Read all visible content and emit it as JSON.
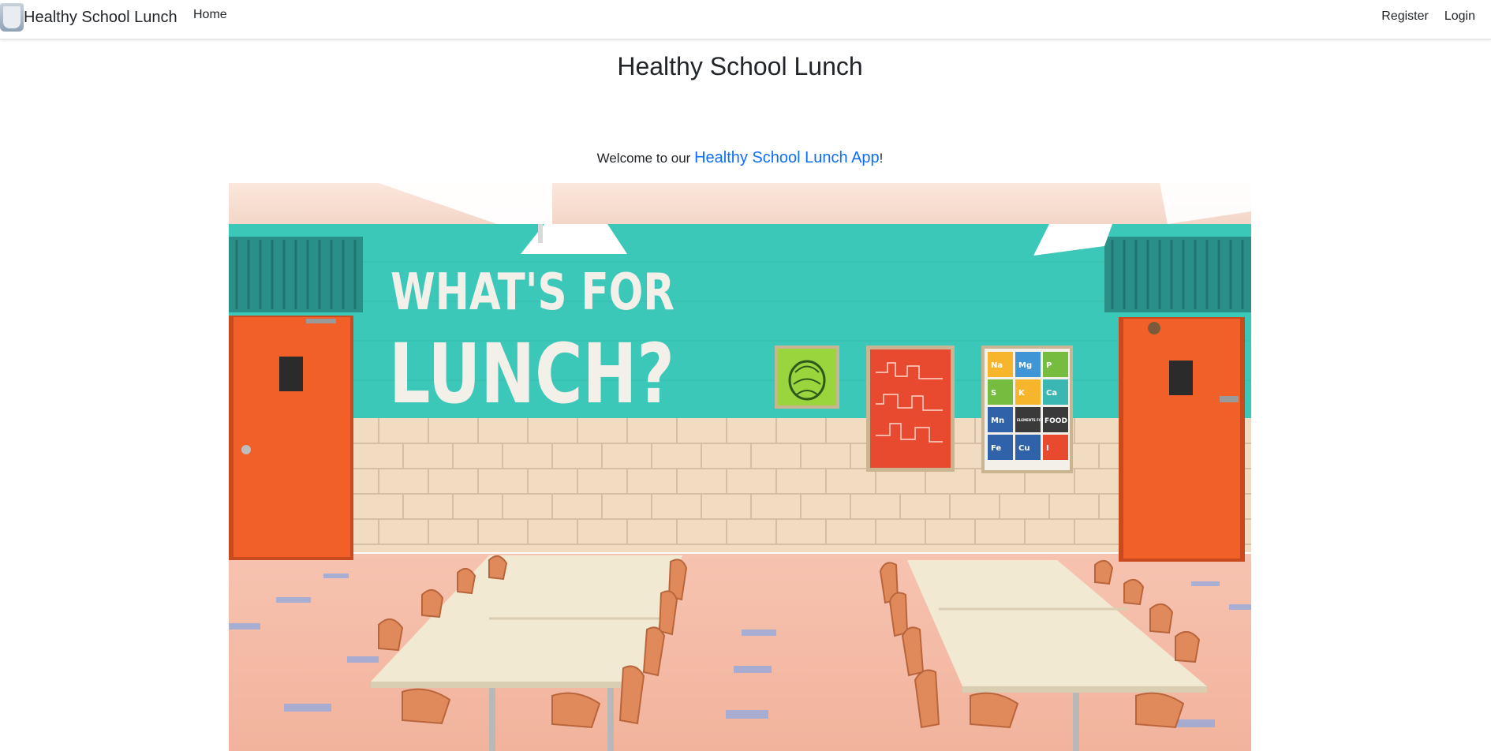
{
  "navbar": {
    "brand_text": "Healthy School Lunch",
    "home_label": "Home",
    "register_label": "Register",
    "login_label": "Login"
  },
  "main": {
    "title": "Healthy School Lunch",
    "welcome_prefix": "Welcome to our ",
    "welcome_link": "Healthy School Lunch App",
    "welcome_suffix": "!"
  },
  "hero_image": {
    "headline_line1": "WHAT'S FOR",
    "headline_line2": "LUNCH?",
    "poster_tiles": [
      "Na",
      "Mg",
      "P",
      "S",
      "K",
      "Ca",
      "Mn",
      "ELEMENTS FOUND IN",
      "FOOD",
      "Fe",
      "Cu",
      "I"
    ]
  },
  "colors": {
    "link": "#0d6efd",
    "wall_teal": "#3cc8b8",
    "door_orange": "#f2602a",
    "tile_cream": "#f1dcc2"
  }
}
